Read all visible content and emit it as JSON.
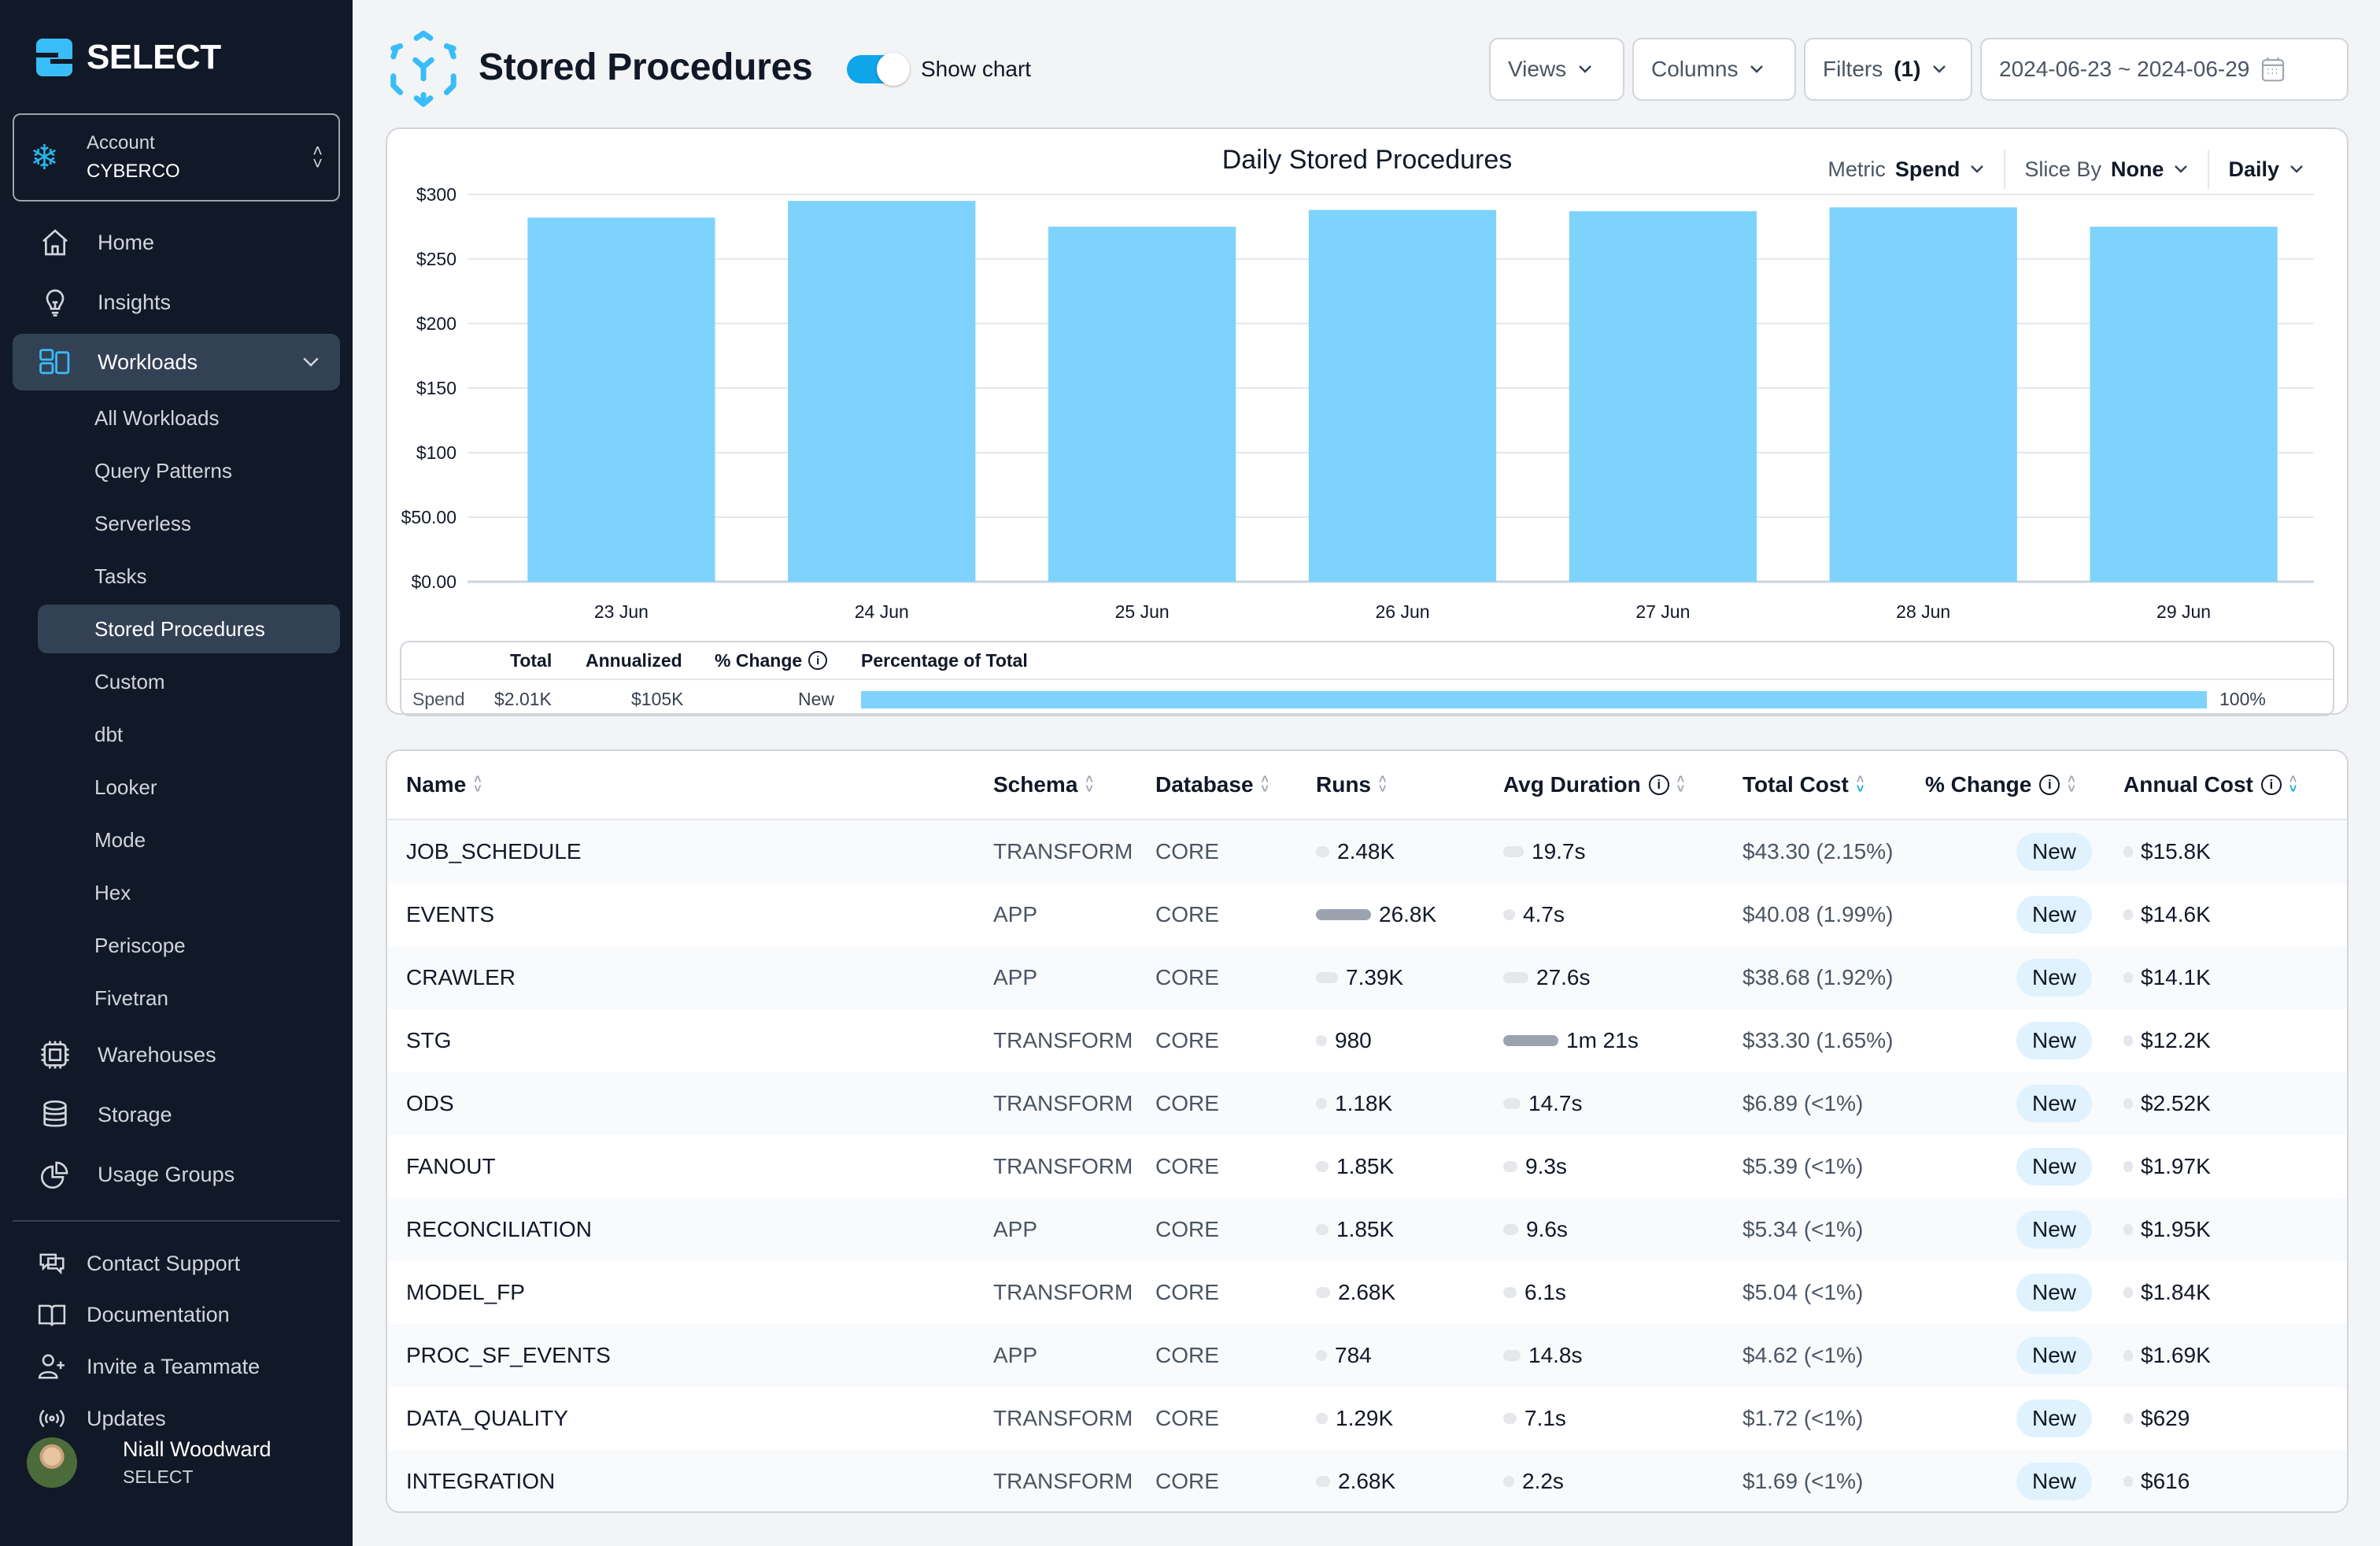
{
  "brand": {
    "name": "SELECT",
    "accent": "#38bdf8"
  },
  "account": {
    "label": "Account",
    "value": "CYBERCO"
  },
  "sidebar": {
    "items": [
      {
        "label": "Home",
        "icon": "home-icon"
      },
      {
        "label": "Insights",
        "icon": "lightbulb-icon"
      },
      {
        "label": "Workloads",
        "icon": "layout-icon",
        "expanded": true
      }
    ],
    "workloads_children": [
      {
        "label": "All Workloads"
      },
      {
        "label": "Query Patterns"
      },
      {
        "label": "Serverless"
      },
      {
        "label": "Tasks"
      },
      {
        "label": "Stored Procedures",
        "active": true
      },
      {
        "label": "Custom"
      },
      {
        "label": "dbt"
      },
      {
        "label": "Looker"
      },
      {
        "label": "Mode"
      },
      {
        "label": "Hex"
      },
      {
        "label": "Periscope"
      },
      {
        "label": "Fivetran"
      }
    ],
    "items_after": [
      {
        "label": "Warehouses",
        "icon": "chip-icon"
      },
      {
        "label": "Storage",
        "icon": "database-icon"
      },
      {
        "label": "Usage Groups",
        "icon": "pie-chart-icon"
      }
    ],
    "footer": [
      {
        "label": "Contact Support",
        "icon": "chat-icon"
      },
      {
        "label": "Documentation",
        "icon": "book-icon"
      },
      {
        "label": "Invite a Teammate",
        "icon": "user-plus-icon"
      },
      {
        "label": "Updates",
        "icon": "broadcast-icon"
      }
    ],
    "user": {
      "name": "Niall Woodward",
      "org": "SELECT"
    }
  },
  "header": {
    "title": "Stored Procedures",
    "show_chart_label": "Show chart",
    "show_chart_on": true,
    "views_label": "Views",
    "columns_label": "Columns",
    "filters_label": "Filters",
    "filters_count": "(1)",
    "date_range": "2024-06-23 ~ 2024-06-29"
  },
  "chart_controls": {
    "metric_label": "Metric",
    "metric_value": "Spend",
    "slice_label": "Slice By",
    "slice_value": "None",
    "granularity": "Daily"
  },
  "chart_data": {
    "type": "bar",
    "title": "Daily Stored Procedures",
    "categories": [
      "23 Jun",
      "24 Jun",
      "25 Jun",
      "26 Jun",
      "27 Jun",
      "28 Jun",
      "29 Jun"
    ],
    "values": [
      282,
      295,
      275,
      288,
      287,
      290,
      275
    ],
    "xlabel": "",
    "ylabel": "Spend",
    "ylim": [
      0,
      300
    ],
    "yticks": [
      0,
      50,
      100,
      150,
      200,
      250,
      300
    ],
    "ytick_labels": [
      "$0.00",
      "$50.00",
      "$100",
      "$150",
      "$200",
      "$250",
      "$300"
    ],
    "grid": true,
    "color": "#7dd3fc"
  },
  "summary": {
    "headers": {
      "total": "Total",
      "annualized": "Annualized",
      "change": "% Change",
      "pct_total": "Percentage of Total"
    },
    "row": {
      "label": "Spend",
      "total": "$2.01K",
      "annualized": "$105K",
      "change": "New",
      "pct_total": 100,
      "pct_total_label": "100%"
    }
  },
  "table": {
    "columns": [
      "Name",
      "Schema",
      "Database",
      "Runs",
      "Avg Duration",
      "Total Cost",
      "% Change",
      "Annual Cost"
    ],
    "sorted_column": "Total Cost",
    "rows": [
      {
        "name": "JOB_SCHEDULE",
        "schema": "TRANSFORM",
        "database": "CORE",
        "runs": "2.48K",
        "runs_frac": 0.09,
        "avg_duration": "19.7s",
        "dur_frac": 0.24,
        "total_cost": "$43.30 (2.15%)",
        "change": "New",
        "annual_cost": "$15.8K"
      },
      {
        "name": "EVENTS",
        "schema": "APP",
        "database": "CORE",
        "runs": "26.8K",
        "runs_frac": 1.0,
        "avg_duration": "4.7s",
        "dur_frac": 0.06,
        "total_cost": "$40.08 (1.99%)",
        "change": "New",
        "annual_cost": "$14.6K"
      },
      {
        "name": "CRAWLER",
        "schema": "APP",
        "database": "CORE",
        "runs": "7.39K",
        "runs_frac": 0.28,
        "avg_duration": "27.6s",
        "dur_frac": 0.34,
        "total_cost": "$38.68 (1.92%)",
        "change": "New",
        "annual_cost": "$14.1K"
      },
      {
        "name": "STG",
        "schema": "TRANSFORM",
        "database": "CORE",
        "runs": "980",
        "runs_frac": 0.04,
        "avg_duration": "1m 21s",
        "dur_frac": 1.0,
        "total_cost": "$33.30 (1.65%)",
        "change": "New",
        "annual_cost": "$12.2K"
      },
      {
        "name": "ODS",
        "schema": "TRANSFORM",
        "database": "CORE",
        "runs": "1.18K",
        "runs_frac": 0.04,
        "avg_duration": "14.7s",
        "dur_frac": 0.18,
        "total_cost": "$6.89 (<1%)",
        "change": "New",
        "annual_cost": "$2.52K"
      },
      {
        "name": "FANOUT",
        "schema": "TRANSFORM",
        "database": "CORE",
        "runs": "1.85K",
        "runs_frac": 0.07,
        "avg_duration": "9.3s",
        "dur_frac": 0.11,
        "total_cost": "$5.39 (<1%)",
        "change": "New",
        "annual_cost": "$1.97K"
      },
      {
        "name": "RECONCILIATION",
        "schema": "APP",
        "database": "CORE",
        "runs": "1.85K",
        "runs_frac": 0.07,
        "avg_duration": "9.6s",
        "dur_frac": 0.12,
        "total_cost": "$5.34 (<1%)",
        "change": "New",
        "annual_cost": "$1.95K"
      },
      {
        "name": "MODEL_FP",
        "schema": "TRANSFORM",
        "database": "CORE",
        "runs": "2.68K",
        "runs_frac": 0.1,
        "avg_duration": "6.1s",
        "dur_frac": 0.08,
        "total_cost": "$5.04 (<1%)",
        "change": "New",
        "annual_cost": "$1.84K"
      },
      {
        "name": "PROC_SF_EVENTS",
        "schema": "APP",
        "database": "CORE",
        "runs": "784",
        "runs_frac": 0.03,
        "avg_duration": "14.8s",
        "dur_frac": 0.18,
        "total_cost": "$4.62 (<1%)",
        "change": "New",
        "annual_cost": "$1.69K"
      },
      {
        "name": "DATA_QUALITY",
        "schema": "TRANSFORM",
        "database": "CORE",
        "runs": "1.29K",
        "runs_frac": 0.05,
        "avg_duration": "7.1s",
        "dur_frac": 0.09,
        "total_cost": "$1.72 (<1%)",
        "change": "New",
        "annual_cost": "$629"
      },
      {
        "name": "INTEGRATION",
        "schema": "TRANSFORM",
        "database": "CORE",
        "runs": "2.68K",
        "runs_frac": 0.1,
        "avg_duration": "2.2s",
        "dur_frac": 0.03,
        "total_cost": "$1.69 (<1%)",
        "change": "New",
        "annual_cost": "$616"
      }
    ]
  }
}
